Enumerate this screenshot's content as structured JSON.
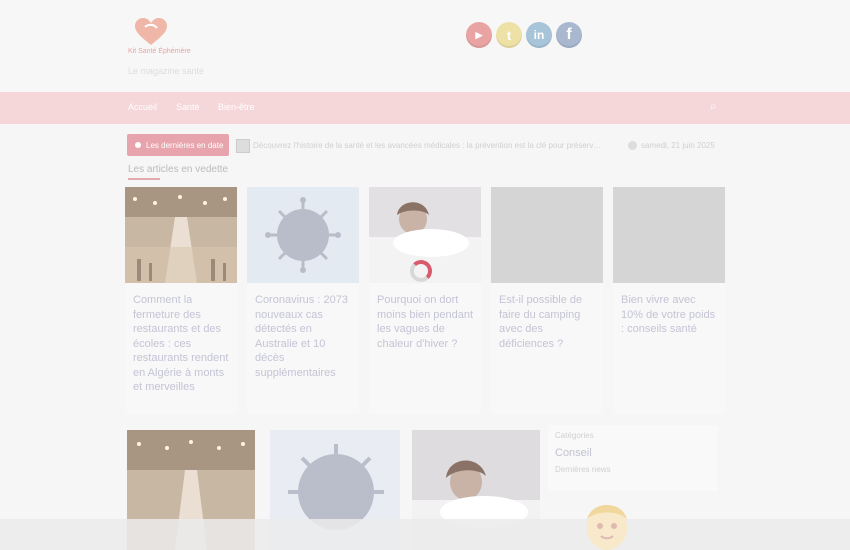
{
  "header": {
    "logo_text": "Kit Santé Éphémère",
    "tagline": "Le magazine santé",
    "social": [
      {
        "icon": "youtube-icon",
        "glyph": "▶",
        "color": "#e9a3a3"
      },
      {
        "icon": "twitter-icon",
        "glyph": "t",
        "color": "#eee1a6"
      },
      {
        "icon": "linkedin-icon",
        "glyph": "in",
        "color": "#a7c4d9"
      },
      {
        "icon": "facebook-icon",
        "glyph": "f",
        "color": "#a9b8cf"
      }
    ]
  },
  "nav": {
    "items": [
      "Accueil",
      "Santé",
      "Bien-être"
    ],
    "search_glyph": "⌕"
  },
  "news": {
    "button_label": "Les dernières en date",
    "ticker": "Découvrez l'histoire de la santé et les avancées médicales : la prévention est la clé pour préserver votre santé au quotidien",
    "date": "samedi, 21 juin 2025"
  },
  "section": {
    "title": "Les articles en vedette"
  },
  "cards": [
    {
      "title": "Comment la fermeture des restaurants et des écoles : ces restaurants rendent en Algérie à monts et merveilles"
    },
    {
      "title": "Coronavirus : 2073 nouveaux cas détectés en Australie et 10 décès supplémentaires"
    },
    {
      "title": "Pourquoi on dort moins bien pendant les vagues de chaleur d'hiver ?"
    },
    {
      "title": "Est-il possible de faire du camping avec des déficiences ?"
    },
    {
      "title": "Bien vivre avec 10% de votre poids : conseils santé"
    }
  ],
  "side_panel": {
    "label_top": "Catégories",
    "label_mid": "Conseil",
    "label_bottom": "Dernières news"
  },
  "colors": {
    "accent": "#e8a4ad",
    "nav_bg": "#f5d6d9",
    "spinner": "#d85a6c"
  }
}
